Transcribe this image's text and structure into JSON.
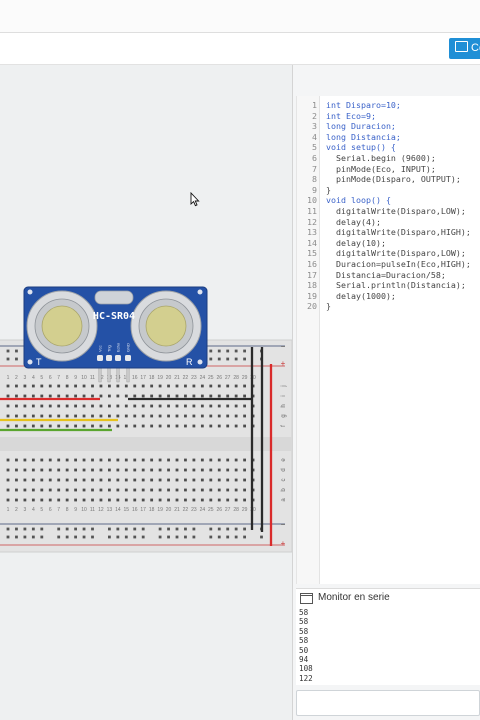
{
  "toolbar": {
    "code_button_label": "Código"
  },
  "sensor": {
    "model": "HC-SR04",
    "pins": [
      "Vcc",
      "Trig",
      "Echo",
      "GND"
    ],
    "corner_labels": [
      "T",
      "R"
    ]
  },
  "breadboard": {
    "column_numbers": [
      "1",
      "2",
      "3",
      "4",
      "5",
      "6",
      "7",
      "8",
      "9",
      "10",
      "11",
      "12",
      "13",
      "14",
      "15",
      "16",
      "17",
      "18",
      "19",
      "20",
      "21",
      "22",
      "23",
      "24",
      "25",
      "26",
      "27",
      "28",
      "29",
      "30"
    ],
    "row_letters_top": [
      "j",
      "i",
      "h",
      "g",
      "f"
    ],
    "row_letters_bottom": [
      "e",
      "d",
      "c",
      "b",
      "a"
    ],
    "rail_plus": "+",
    "rail_minus": "−"
  },
  "code": {
    "line_numbers": [
      "1",
      "2",
      "3",
      "4",
      "5",
      "6",
      "7",
      "8",
      "9",
      "10",
      "11",
      "12",
      "13",
      "14",
      "15",
      "16",
      "17",
      "18",
      "19",
      "20"
    ],
    "lines": [
      "int Disparo=10;",
      "int Eco=9;",
      "long Duracion;",
      "long Distancia;",
      "void setup() {",
      "  Serial.begin (9600);",
      "  pinMode(Eco, INPUT);",
      "  pinMode(Disparo, OUTPUT);",
      "}",
      "void loop() {",
      "  digitalWrite(Disparo,LOW);",
      "  delay(4);",
      "  digitalWrite(Disparo,HIGH);",
      "  delay(10);",
      "  digitalWrite(Disparo,LOW);",
      "  Duracion=pulseIn(Eco,HIGH);",
      "  Distancia=Duracion/58;",
      "  Serial.println(Distancia);",
      "  delay(1000);",
      "}"
    ]
  },
  "serial_monitor": {
    "title": "Monitor en serie",
    "output": [
      "58",
      "58",
      "58",
      "58",
      "50",
      "94",
      "108",
      "122"
    ],
    "input_value": ""
  },
  "colors": {
    "accent": "#1f8fd6",
    "sensor_board": "#2451a6",
    "wire_red": "#d92b2b",
    "wire_yellow": "#e6c21e",
    "wire_green": "#5aa52e",
    "wire_black": "#2a2a2a"
  },
  "icons": [
    "code-icon",
    "serial-monitor-icon",
    "mouse-pointer-icon"
  ]
}
